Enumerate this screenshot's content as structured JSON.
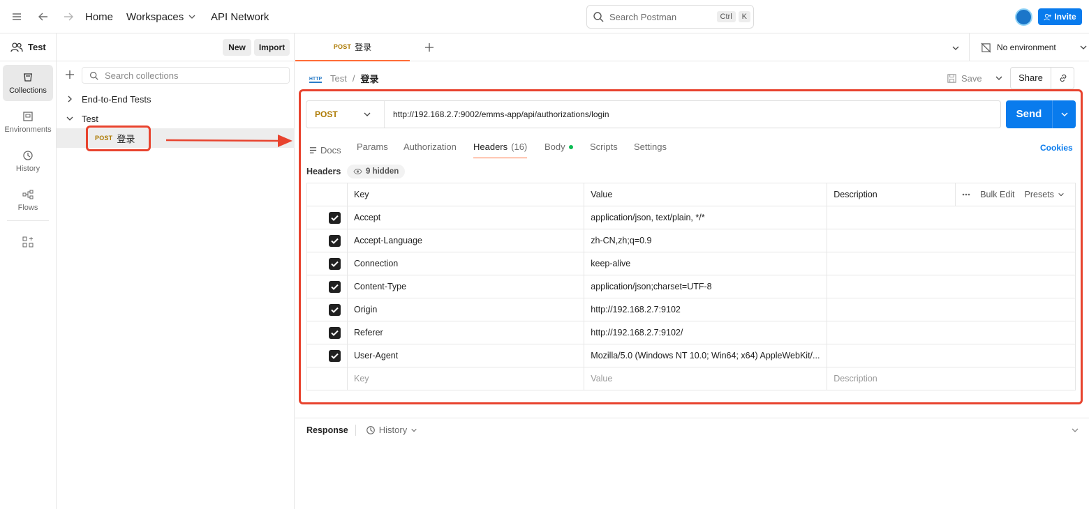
{
  "topbar": {
    "nav_home": "Home",
    "nav_workspaces": "Workspaces",
    "nav_api_network": "API Network",
    "search_placeholder": "Search Postman",
    "search_kbd_ctrl": "Ctrl",
    "search_kbd_k": "K",
    "invite_label": "Invite"
  },
  "workspace": {
    "name": "Test",
    "new_label": "New",
    "import_label": "Import"
  },
  "rail": {
    "items": [
      {
        "label": "Collections",
        "icon": "collections-icon"
      },
      {
        "label": "Environments",
        "icon": "environments-icon"
      },
      {
        "label": "History",
        "icon": "history-icon"
      },
      {
        "label": "Flows",
        "icon": "flows-icon"
      }
    ]
  },
  "sidebar": {
    "search_placeholder": "Search collections",
    "tree": [
      {
        "label": "End-to-End Tests",
        "expanded": false
      },
      {
        "label": "Test",
        "expanded": true
      },
      {
        "method": "POST",
        "label": "登录",
        "selected": true
      }
    ]
  },
  "tabs": {
    "active_method": "POST",
    "active_name": "登录",
    "environment": "No environment"
  },
  "breadcrumb": {
    "icon_text": "HTTP",
    "collection": "Test",
    "separator": "/",
    "request": "登录",
    "save_label": "Save",
    "share_label": "Share"
  },
  "request": {
    "method": "POST",
    "url": "http://192.168.2.7:9002/emms-app/api/authorizations/login",
    "send_label": "Send"
  },
  "subtabs": {
    "docs": "Docs",
    "params": "Params",
    "authorization": "Authorization",
    "headers": "Headers",
    "headers_count": "(16)",
    "body": "Body",
    "scripts": "Scripts",
    "settings": "Settings",
    "cookies": "Cookies"
  },
  "headers_section": {
    "title": "Headers",
    "hidden_label": "9 hidden",
    "columns": {
      "key": "Key",
      "value": "Value",
      "description": "Description"
    },
    "bulk_edit": "Bulk Edit",
    "presets": "Presets",
    "rows": [
      {
        "key": "Accept",
        "value": "application/json, text/plain, */*",
        "checked": true
      },
      {
        "key": "Accept-Language",
        "value": "zh-CN,zh;q=0.9",
        "checked": true
      },
      {
        "key": "Connection",
        "value": "keep-alive",
        "checked": true
      },
      {
        "key": "Content-Type",
        "value": "application/json;charset=UTF-8",
        "checked": true
      },
      {
        "key": "Origin",
        "value": "http://192.168.2.7:9102",
        "checked": true
      },
      {
        "key": "Referer",
        "value": "http://192.168.2.7:9102/",
        "checked": true
      },
      {
        "key": "User-Agent",
        "value": "Mozilla/5.0 (Windows NT 10.0; Win64; x64) AppleWebKit/...",
        "checked": true
      }
    ],
    "placeholder": {
      "key": "Key",
      "value": "Value",
      "description": "Description"
    }
  },
  "response": {
    "label": "Response",
    "history_label": "History"
  },
  "colors": {
    "accent": "#ff6c37",
    "primary": "#097bed",
    "post_method": "#ad7a03",
    "annotation_red": "#e8432e"
  }
}
